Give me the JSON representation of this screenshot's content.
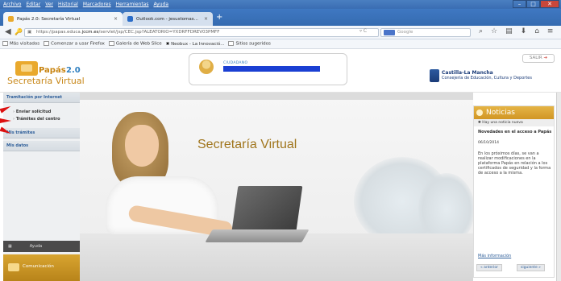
{
  "menu": [
    "Archivo",
    "Editar",
    "Ver",
    "Historial",
    "Marcadores",
    "Herramientas",
    "Ayuda"
  ],
  "tabs": [
    {
      "label": "Papás 2.0: Secretaría Virtual",
      "close": "×",
      "active": true
    },
    {
      "label": "Outlook.com - jesustomas...",
      "close": "×",
      "active": false
    }
  ],
  "new_tab": "+",
  "nav": {
    "url_prefix": "https://papas.educa.",
    "url_domain": "jccm.es",
    "url_rest": "/servlet/jsp/CEC.jsp?ALEATORIO=YXDRFFDREV03PMFF",
    "search_placeholder": "Google"
  },
  "bookmarks": [
    "Más visitados",
    "Comenzar a usar Firefox",
    "Galería de Web Slice",
    "Neobux - La Innovació...",
    "Sitios sugeridos"
  ],
  "header": {
    "logo_papas": "Papás",
    "logo_version": "2.0",
    "logo_subtitle": "Secretaría Virtual",
    "user_label": "CIUDADANO",
    "logout": "SALIR",
    "gov_title": "Castilla-La Mancha",
    "gov_subtitle": "Consejería de Educación, Cultura y Deportes"
  },
  "sidebar": {
    "section": "Tramitación por Internet",
    "items": [
      "Enviar solicitud",
      "Trámites del centro"
    ],
    "my_procedures": "Mis trámites",
    "my_data": "Mis datos",
    "help": "Ayuda",
    "communication": "Comunicación"
  },
  "main": {
    "title": "Secretaría Virtual"
  },
  "news": {
    "header": "Noticias",
    "sub": "Hay una noticia nueva",
    "title": "Novedades en el acceso a Papás",
    "date": "06/10/2014",
    "body": "En los próximos días, se van a realizar modificaciones en la plataforma Papás en relación a los certificados de seguridad y la forma de acceso a la misma.",
    "more": "Más información",
    "prev": "« anterior",
    "next": "siguiente »"
  },
  "colors": {
    "accent": "#c8881a",
    "link": "#2f5f9a",
    "highlight_arrow": "#dd1111"
  }
}
